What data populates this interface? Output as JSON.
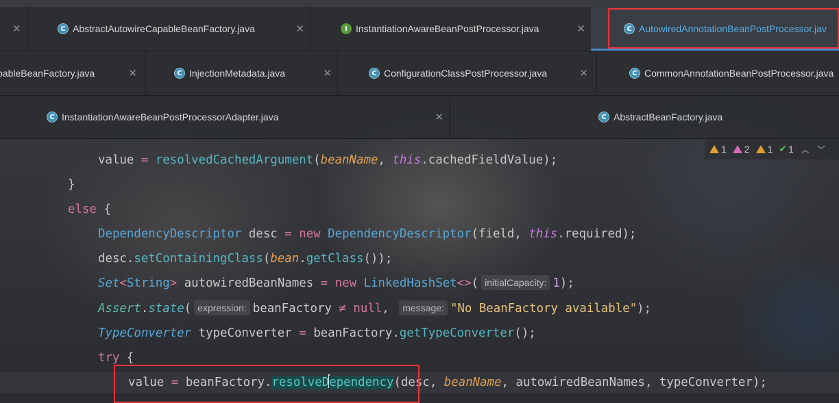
{
  "tabs": {
    "row1": [
      {
        "label": "AbstractAutowireCapableBeanFactory.java",
        "icon": "class-icon"
      },
      {
        "label": "InstantiationAwareBeanPostProcessor.java",
        "icon": "interface-icon"
      },
      {
        "label": "AutowiredAnnotationBeanPostProcessor.jav",
        "icon": "class-icon",
        "active": true
      }
    ],
    "row2": [
      {
        "label": "pableBeanFactory.java"
      },
      {
        "label": "InjectionMetadata.java",
        "icon": "class-icon"
      },
      {
        "label": "ConfigurationClassPostProcessor.java",
        "icon": "class-icon"
      },
      {
        "label": "CommonAnnotationBeanPostProcessor.java",
        "icon": "class-icon"
      }
    ],
    "row3": [
      {
        "label": "InstantiationAwareBeanPostProcessorAdapter.java",
        "icon": "class-icon"
      },
      {
        "label": "AbstractBeanFactory.java",
        "icon": "class-icon"
      }
    ]
  },
  "inspections": {
    "warnings_a": "1",
    "weak_warnings": "2",
    "warnings_b": "1",
    "typos": "1"
  },
  "code": {
    "l1_value": "value",
    "l1_eq": "=",
    "l1_call": "resolvedCachedArgument",
    "l1_param": "beanName",
    "l1_this": "this",
    "l1_field": ".cachedFieldValue);",
    "l2_brace": "}",
    "l3_else": "else",
    "l3_brace": "{",
    "l4_type": "DependencyDescriptor",
    "l4_var": "desc",
    "l4_eq": "=",
    "l4_new": "new",
    "l4_ctor": "DependencyDescriptor",
    "l4_args": "(field,",
    "l4_this": "this",
    "l4_tail": ".required);",
    "l5_var": "desc.",
    "l5_call": "setContainingClass",
    "l5_open": "(",
    "l5_param": "bean",
    "l5_dot": ".",
    "l5_call2": "getClass",
    "l5_tail": "());",
    "l6_type": "Set",
    "l6_gen_open": "<",
    "l6_gen": "String",
    "l6_gen_close": ">",
    "l6_var": "autowiredBeanNames",
    "l6_eq": "=",
    "l6_new": "new",
    "l6_ctor": "LinkedHashSet",
    "l6_diamond": "<>",
    "l6_open": "(",
    "l6_hint": "initialCapacity:",
    "l6_num": "1",
    "l6_tail": ");",
    "l7_type": "Assert",
    "l7_dot": ".",
    "l7_call": "state",
    "l7_open": "(",
    "l7_hint1": "expression:",
    "l7_var": "beanFactory",
    "l7_ne": "≠",
    "l7_null": "null",
    "l7_comma": ",",
    "l7_hint2": "message:",
    "l7_str": "\"No BeanFactory available\"",
    "l7_tail": ");",
    "l8_type": "TypeConverter",
    "l8_var": "typeConverter",
    "l8_eq": "=",
    "l8_obj": "beanFactory.",
    "l8_call": "getTypeConverter",
    "l8_tail": "();",
    "l9_try": "try",
    "l9_brace": "{",
    "l10_var": "value",
    "l10_eq": "=",
    "l10_obj": "beanFactory.",
    "l10_call_a": "resolveD",
    "l10_call_b": "ependency",
    "l10_open": "(",
    "l10_arg1": "desc,",
    "l10_param": "beanName",
    "l10_tail": ", autowiredBeanNames, typeConverter);"
  },
  "colors": {
    "highlight_box": "#e8353b",
    "active_tab_text": "#5aaee4",
    "keyword": "#d2779a",
    "method": "#56b6c2",
    "type": "#58a6d6",
    "string": "#e5c07b"
  }
}
